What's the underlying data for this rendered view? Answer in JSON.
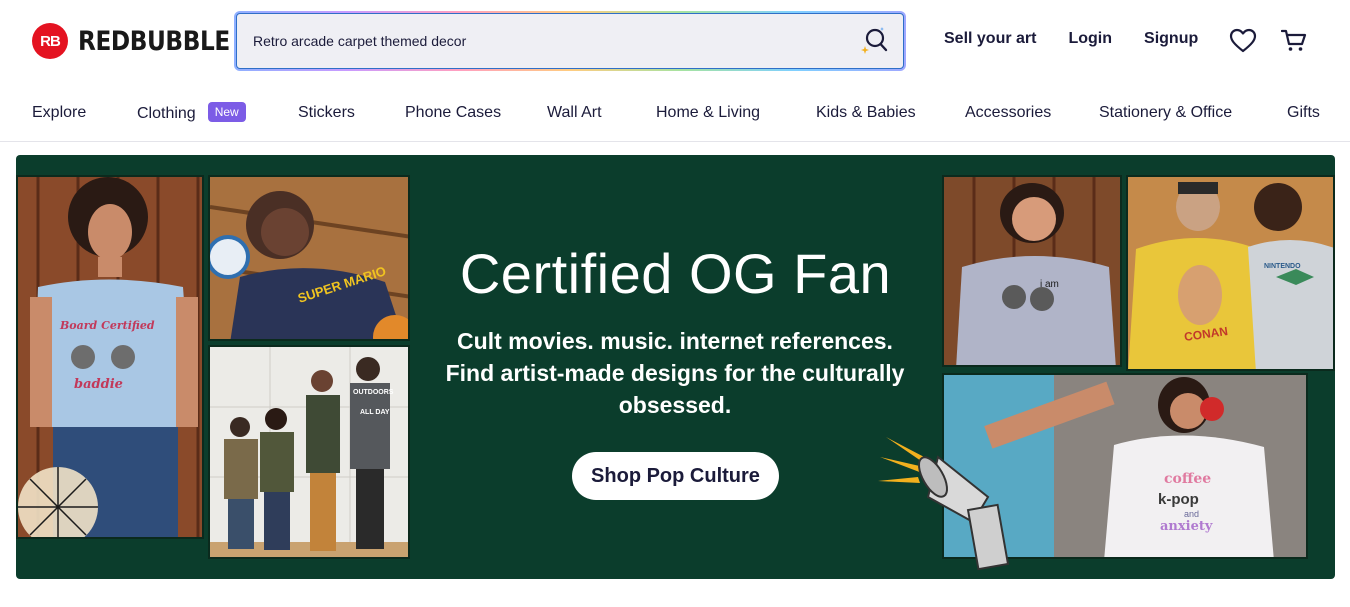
{
  "header": {
    "logo_mark": "RB",
    "logo_text": "REDBUBBLE",
    "search": {
      "value": "Retro arcade carpet themed decor"
    },
    "links": [
      "Sell your art",
      "Login",
      "Signup"
    ],
    "icons": {
      "search": "search-icon",
      "wishlist": "heart-icon",
      "cart": "cart-icon"
    }
  },
  "nav": {
    "items": [
      "Explore",
      "Clothing",
      "Stickers",
      "Phone Cases",
      "Wall Art",
      "Home & Living",
      "Kids & Babies",
      "Accessories",
      "Stationery & Office",
      "Gifts"
    ],
    "clothing_badge": "New"
  },
  "hero": {
    "title": "Certified OG Fan",
    "subtitle": "Cult movies. music. internet references. Find artist-made designs for the culturally obsessed.",
    "cta": "Shop Pop Culture",
    "shirt_texts": {
      "raccoon_top": "Board Certified",
      "raccoon_bottom": "baddie",
      "mario": "SUPER MARIO",
      "conan": "CONAN",
      "nintendo": "NINTENDO",
      "i_am": "i am",
      "coffee": "coffee",
      "kpop": "k-pop",
      "and": "and",
      "anxiety": "anxiety",
      "outdoors": "OUTDOORS",
      "all_day": "ALL DAY"
    }
  },
  "colors": {
    "brand_red": "#e41321",
    "hero_green": "#0b3d2c",
    "badge_purple": "#7c5ce6",
    "text_navy": "#1b1b3a"
  }
}
